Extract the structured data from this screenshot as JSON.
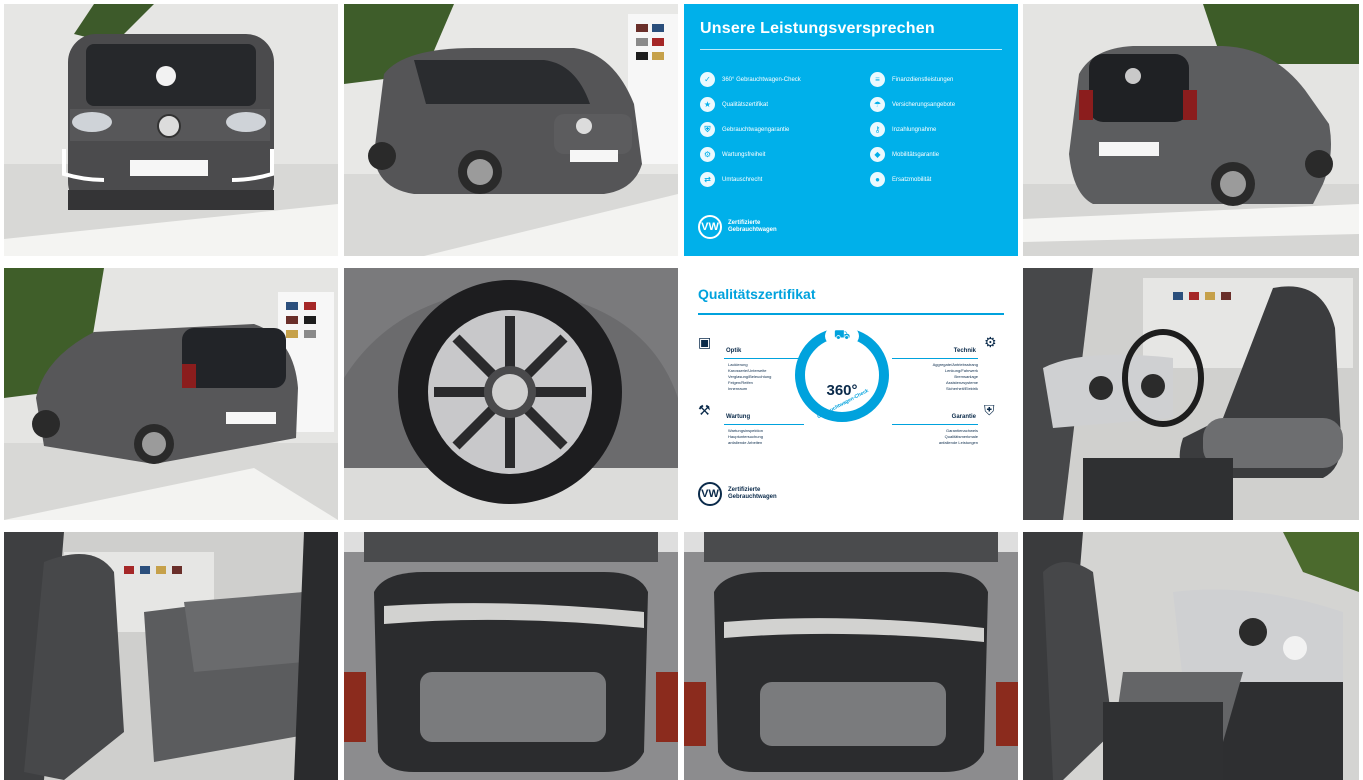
{
  "gallery": {
    "photos": [
      {
        "name": "front-view-photo"
      },
      {
        "name": "front-three-quarter-photo"
      },
      {
        "name": "rear-view-photo"
      },
      {
        "name": "rear-three-quarter-photo"
      },
      {
        "name": "wheel-photo"
      },
      {
        "name": "front-seats-photo"
      },
      {
        "name": "rear-seats-photo"
      },
      {
        "name": "trunk-photo"
      },
      {
        "name": "trunk-photo-2"
      },
      {
        "name": "interior-dashboard-photo"
      }
    ]
  },
  "promise_panel": {
    "title": "Unsere Leistungsversprechen",
    "items_left": [
      "360° Gebrauchtwagen-Check",
      "Qualitätszertifikat",
      "Gebrauchtwagengarantie",
      "Wartungsfreiheit",
      "Umtauschrecht"
    ],
    "items_right": [
      "Finanzdienstleistungen",
      "Versicherungsangebote",
      "Inzahlungnahme",
      "Mobilitätsgarantie",
      "Ersatzmobilität"
    ],
    "logo_text_line1": "Zertifizierte",
    "logo_text_line2": "Gebrauchtwagen",
    "logo_glyph": "VW",
    "color_background": "#00b0ea"
  },
  "certificate_panel": {
    "title": "Qualitätszertifikat",
    "badge_number": "360°",
    "badge_arc_text": "Gebrauchtwagen-Check",
    "sections": {
      "optik": {
        "heading": "Optik",
        "items": [
          "Lackierung",
          "Karosserie/Unterseite",
          "Verglasung/Beleuchtung",
          "Felgen/Reifen",
          "Innenraum"
        ]
      },
      "technik": {
        "heading": "Technik",
        "items": [
          "Aggregate/Antriebsstrang",
          "Lenkung/Fahrwerk",
          "Bremsanlage",
          "Assistenzsysteme",
          "Sicherheit/Elektrik"
        ]
      },
      "wartung": {
        "heading": "Wartung",
        "items": [
          "Wartungsinspektion",
          "Hauptuntersuchung",
          "anfallende Arbeiten"
        ]
      },
      "garantie": {
        "heading": "Garantie",
        "items": [
          "Garantienachweis",
          "Qualitätsmerkmale",
          "anfallende Leistungen"
        ]
      }
    },
    "logo_text_line1": "Zertifizierte",
    "logo_text_line2": "Gebrauchtwagen",
    "logo_glyph": "VW",
    "color_accent": "#00a2dd"
  }
}
